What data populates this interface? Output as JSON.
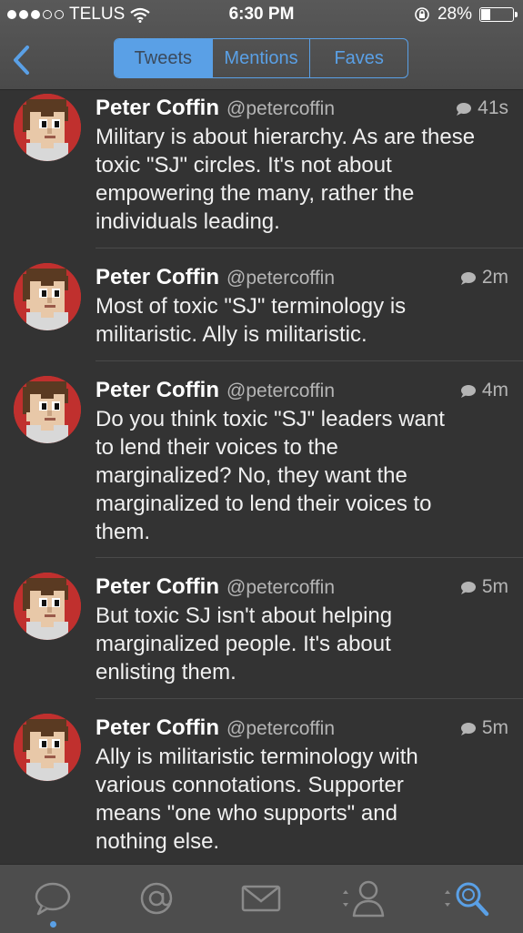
{
  "status_bar": {
    "carrier": "TELUS",
    "time": "6:30 PM",
    "battery_percent": "28%",
    "signal_bars_filled": 3,
    "signal_bars_total": 5
  },
  "header": {
    "back_icon": "chevron-left-icon",
    "segments": [
      {
        "label": "Tweets",
        "active": true
      },
      {
        "label": "Mentions",
        "active": false
      },
      {
        "label": "Faves",
        "active": false
      }
    ]
  },
  "tweets": [
    {
      "name": "Peter Coffin",
      "handle": "@petercoffin",
      "time": "41s",
      "lines": [
        "Military is about hierarchy. As are these",
        "toxic \"SJ\" circles. It's not about",
        "empowering the many, rather the",
        "individuals leading."
      ]
    },
    {
      "name": "Peter Coffin",
      "handle": "@petercoffin",
      "time": "2m",
      "lines": [
        "Most of toxic \"SJ\" terminology is",
        "militaristic. Ally is militaristic."
      ]
    },
    {
      "name": "Peter Coffin",
      "handle": "@petercoffin",
      "time": "4m",
      "lines": [
        "Do you think toxic \"SJ\" leaders want",
        "to lend their voices to the",
        "marginalized? No, they want the",
        "marginalized to lend their voices to",
        "them."
      ]
    },
    {
      "name": "Peter Coffin",
      "handle": "@petercoffin",
      "time": "5m",
      "lines": [
        "But toxic SJ isn't about helping",
        "marginalized people. It's about",
        "enlisting them."
      ]
    },
    {
      "name": "Peter Coffin",
      "handle": "@petercoffin",
      "time": "5m",
      "lines": [
        "Ally is militaristic terminology with",
        "various connotations. Supporter",
        "means \"one who supports\" and",
        "nothing else."
      ]
    }
  ],
  "tab_bar": {
    "tabs": [
      {
        "icon": "chat-bubble-icon",
        "active": true
      },
      {
        "icon": "at-sign-icon",
        "active": false
      },
      {
        "icon": "envelope-icon",
        "active": false
      },
      {
        "icon": "profile-icon",
        "active": false
      },
      {
        "icon": "search-icon",
        "active": false
      }
    ]
  },
  "colors": {
    "accent": "#5aa0e6",
    "background": "#333333",
    "avatar_ring": "#c0302e"
  }
}
